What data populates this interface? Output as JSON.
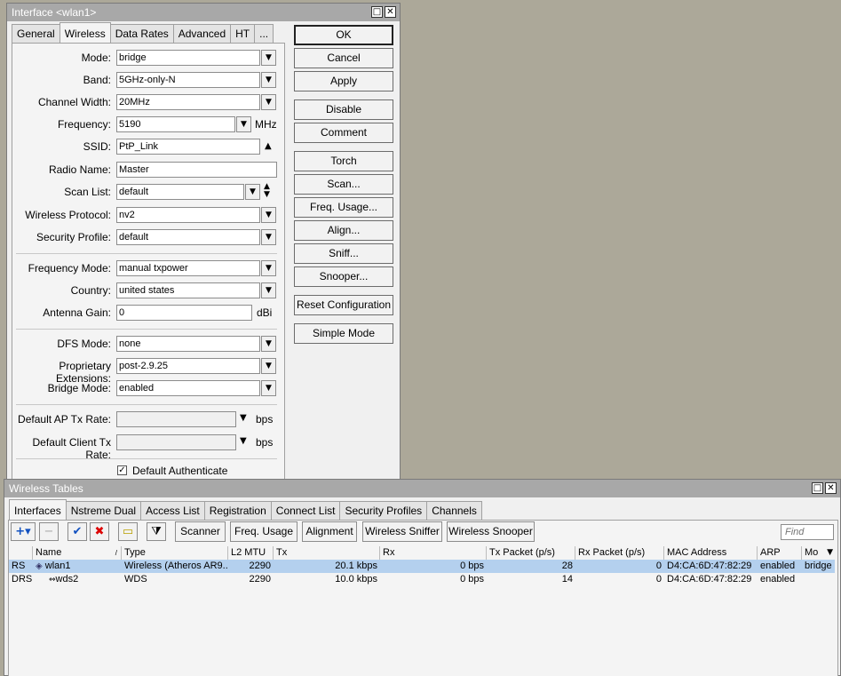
{
  "interface_window": {
    "title": "Interface <wlan1>",
    "tabs": [
      "General",
      "Wireless",
      "Data Rates",
      "Advanced",
      "HT",
      "..."
    ],
    "active_tab": "Wireless",
    "fields": {
      "mode": {
        "label": "Mode:",
        "value": "bridge"
      },
      "band": {
        "label": "Band:",
        "value": "5GHz-only-N"
      },
      "channel_width": {
        "label": "Channel Width:",
        "value": "20MHz"
      },
      "frequency": {
        "label": "Frequency:",
        "value": "5190",
        "unit": "MHz"
      },
      "ssid": {
        "label": "SSID:",
        "value": "PtP_Link"
      },
      "radio_name": {
        "label": "Radio Name:",
        "value": "Master"
      },
      "scan_list": {
        "label": "Scan List:",
        "value": "default"
      },
      "wireless_protocol": {
        "label": "Wireless Protocol:",
        "value": "nv2"
      },
      "security_profile": {
        "label": "Security Profile:",
        "value": "default"
      },
      "frequency_mode": {
        "label": "Frequency Mode:",
        "value": "manual txpower"
      },
      "country": {
        "label": "Country:",
        "value": "united states"
      },
      "antenna_gain": {
        "label": "Antenna Gain:",
        "value": "0",
        "unit": "dBi"
      },
      "dfs_mode": {
        "label": "DFS Mode:",
        "value": "none"
      },
      "proprietary_extensions": {
        "label": "Proprietary Extensions:",
        "value": "post-2.9.25"
      },
      "bridge_mode": {
        "label": "Bridge Mode:",
        "value": "enabled"
      },
      "default_ap_tx_rate": {
        "label": "Default AP Tx Rate:",
        "value": "",
        "unit": "bps"
      },
      "default_client_tx_rate": {
        "label": "Default Client Tx Rate:",
        "value": "",
        "unit": "bps"
      },
      "default_authenticate": {
        "label": "Default Authenticate",
        "checked": true
      }
    },
    "buttons": {
      "ok": "OK",
      "cancel": "Cancel",
      "apply": "Apply",
      "disable": "Disable",
      "comment": "Comment",
      "torch": "Torch",
      "scan": "Scan...",
      "freq_usage": "Freq. Usage...",
      "align": "Align...",
      "sniff": "Sniff...",
      "snooper": "Snooper...",
      "reset_configuration": "Reset Configuration",
      "simple_mode": "Simple Mode"
    }
  },
  "wireless_tables": {
    "title": "Wireless Tables",
    "tabs": [
      "Interfaces",
      "Nstreme Dual",
      "Access List",
      "Registration",
      "Connect List",
      "Security Profiles",
      "Channels"
    ],
    "active_tab": "Interfaces",
    "toolbar": {
      "scanner": "Scanner",
      "freq_usage": "Freq. Usage",
      "alignment": "Alignment",
      "wireless_sniffer": "Wireless Sniffer",
      "wireless_snooper": "Wireless Snooper",
      "find_placeholder": "Find"
    },
    "columns": [
      "Name",
      "Type",
      "L2 MTU",
      "Tx",
      "Rx",
      "Tx Packet (p/s)",
      "Rx Packet (p/s)",
      "MAC Address",
      "ARP",
      "Mo"
    ],
    "rows": [
      {
        "flags": "RS",
        "name": "wlan1",
        "type": "Wireless (Atheros AR9...",
        "l2mtu": "2290",
        "tx": "20.1 kbps",
        "rx": "0 bps",
        "tx_packet": "28",
        "rx_packet": "0",
        "mac": "D4:CA:6D:47:82:29",
        "arp": "enabled",
        "mode": "bridge"
      },
      {
        "flags": "DRS",
        "name": "wds2",
        "type": "WDS",
        "l2mtu": "2290",
        "tx": "10.0 kbps",
        "rx": "0 bps",
        "tx_packet": "14",
        "rx_packet": "0",
        "mac": "D4:CA:6D:47:82:29",
        "arp": "enabled",
        "mode": ""
      }
    ]
  },
  "colors": {
    "selected_row": "#b4d0ee",
    "desktop": "#aca899",
    "titlebar": "#a8a8a8"
  }
}
